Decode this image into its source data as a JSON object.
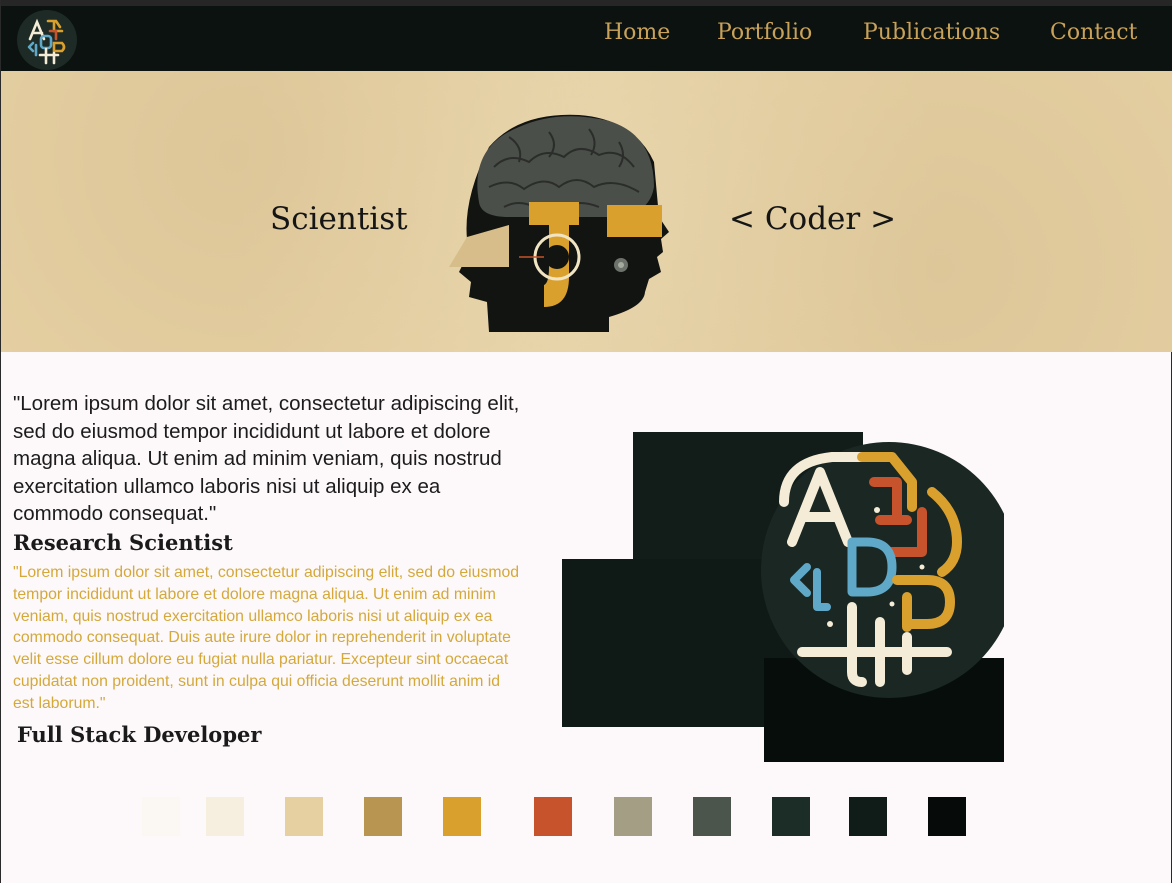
{
  "nav": {
    "logo_alt": "ADP",
    "links": [
      "Home",
      "Portfolio",
      "Publications",
      "Contact"
    ]
  },
  "hero": {
    "left_word": "Scientist",
    "right_word": "< Coder >"
  },
  "intro_quote": "\"Lorem ipsum dolor sit amet, consectetur adipiscing elit, sed do eiusmod tempor incididunt ut labore et dolore magna aliqua. Ut enim ad minim veniam, quis nostrud exercitation ullamco laboris nisi ut aliquip ex ea commodo consequat.\"",
  "roles": [
    {
      "title": "Research Scientist",
      "description": "\"Lorem ipsum dolor sit amet, consectetur adipiscing elit, sed do eiusmod tempor incididunt ut labore et dolore magna aliqua. Ut enim ad minim veniam, quis nostrud exercitation ullamco laboris nisi ut aliquip ex ea commodo consequat. Duis aute irure dolor in reprehenderit in voluptate velit esse cillum dolore eu fugiat nulla pariatur. Excepteur sint occaecat cupidatat non proident, sunt in culpa qui officia deserunt mollit anim id est laborum.\""
    },
    {
      "title": "Full Stack Developer"
    }
  ],
  "palette": [
    "#fbf7f3",
    "#f6efdf",
    "#e6cfa0",
    "#b89551",
    "#d9a02e",
    "#c6532b",
    "#a39e84",
    "#4b554b",
    "#1c2c26",
    "#0f1c18",
    "#060b09"
  ],
  "colors": {
    "nav_bg": "#0b120f",
    "nav_text": "#c9a25a",
    "hero_bg": "#e6d1a4",
    "accent_gold": "#d4a83a",
    "dark_green": "#121d19"
  }
}
